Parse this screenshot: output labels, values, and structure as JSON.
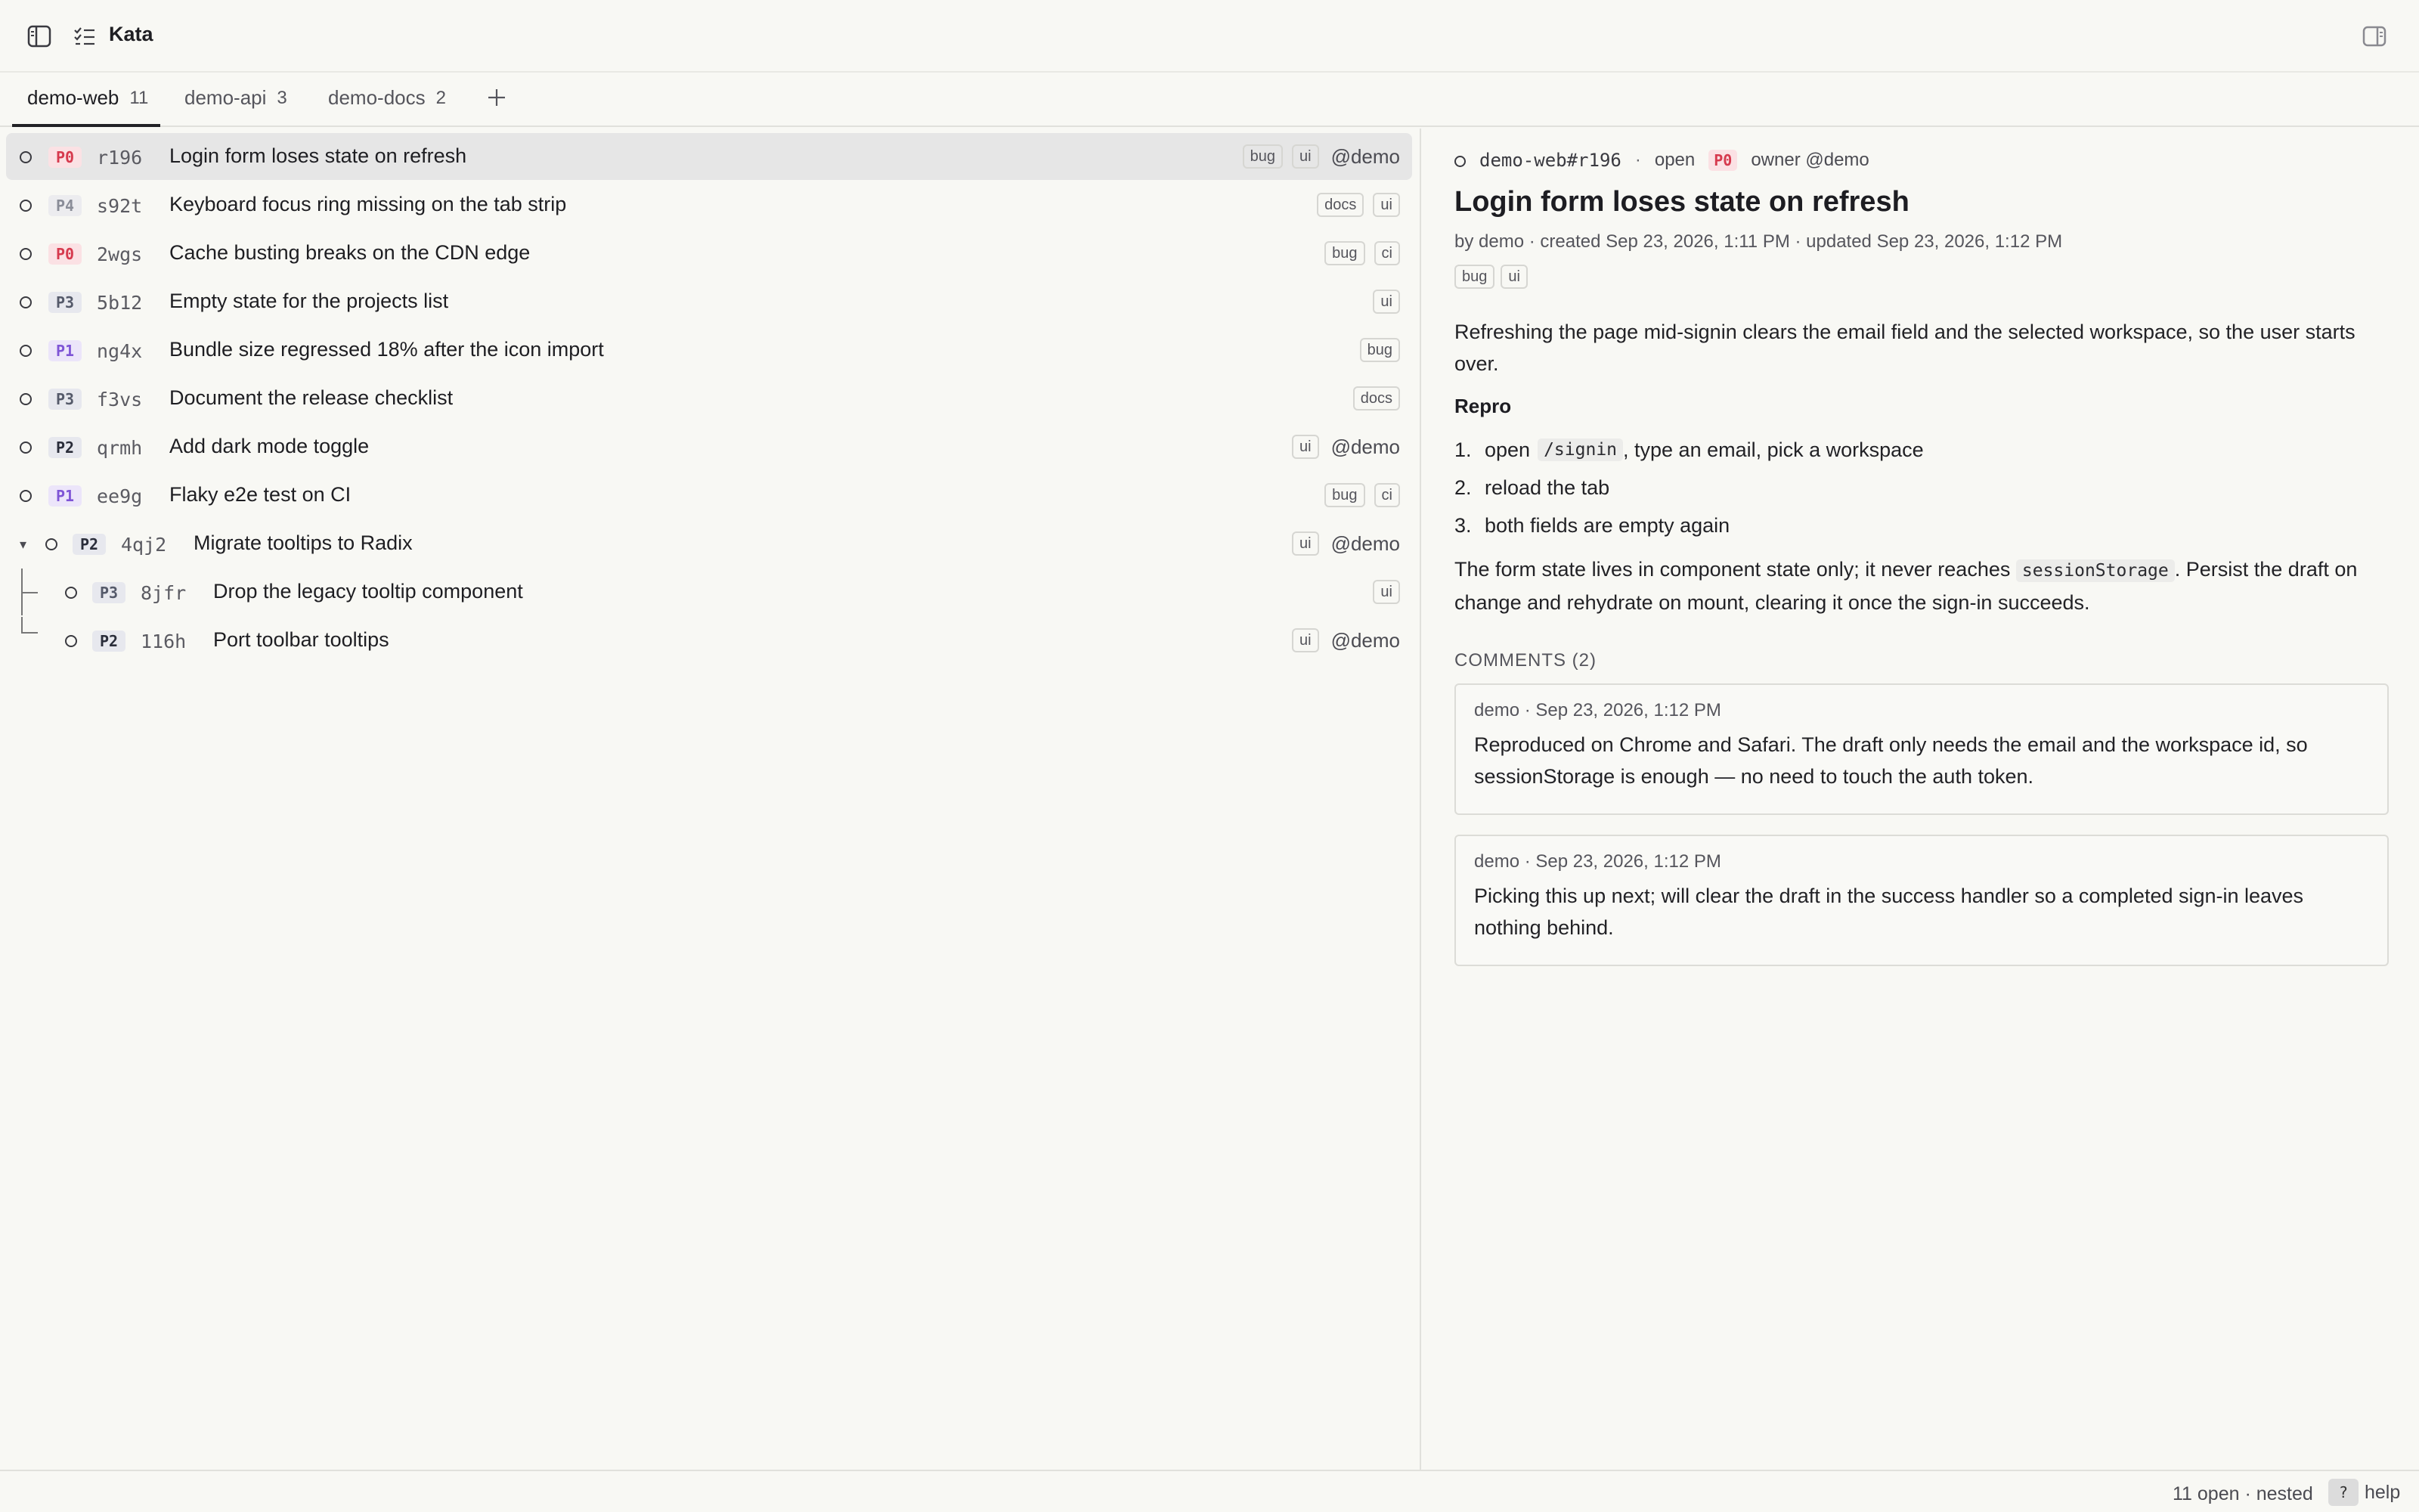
{
  "app": {
    "title": "Kata"
  },
  "tabs": [
    {
      "label": "demo-web",
      "count": "11"
    },
    {
      "label": "demo-api",
      "count": "3"
    },
    {
      "label": "demo-docs",
      "count": "2"
    }
  ],
  "icons": {
    "sidebar_toggle": "sidebar-toggle-icon",
    "tasks": "checklist-icon",
    "panel_right": "panel-right-icon",
    "add_tab": "plus-icon",
    "status_open": "open-circle-icon",
    "expand": "caret-down-icon"
  },
  "colors": {
    "p0": "#d63a4e",
    "p1": "#7f55d6",
    "selected_row": "#e6e6e6",
    "background": "#f8f8f4"
  },
  "issues": [
    {
      "prio": "P0",
      "id": "r196",
      "title": "Login form loses state on refresh",
      "tags": [
        "bug",
        "ui"
      ],
      "owner": "@demo"
    },
    {
      "prio": "P4",
      "id": "s92t",
      "title": "Keyboard focus ring missing on the tab strip",
      "tags": [
        "docs",
        "ui"
      ],
      "owner": ""
    },
    {
      "prio": "P0",
      "id": "2wgs",
      "title": "Cache busting breaks on the CDN edge",
      "tags": [
        "bug",
        "ci"
      ],
      "owner": ""
    },
    {
      "prio": "P3",
      "id": "5b12",
      "title": "Empty state for the projects list",
      "tags": [
        "ui"
      ],
      "owner": ""
    },
    {
      "prio": "P1",
      "id": "ng4x",
      "title": "Bundle size regressed 18% after the icon import",
      "tags": [
        "bug"
      ],
      "owner": ""
    },
    {
      "prio": "P3",
      "id": "f3vs",
      "title": "Document the release checklist",
      "tags": [
        "docs"
      ],
      "owner": ""
    },
    {
      "prio": "P2",
      "id": "qrmh",
      "title": "Add dark mode toggle",
      "tags": [
        "ui"
      ],
      "owner": "@demo"
    },
    {
      "prio": "P1",
      "id": "ee9g",
      "title": "Flaky e2e test on CI",
      "tags": [
        "bug",
        "ci"
      ],
      "owner": ""
    },
    {
      "prio": "P2",
      "id": "4qj2",
      "title": "Migrate tooltips to Radix",
      "tags": [
        "ui"
      ],
      "owner": "@demo"
    },
    {
      "prio": "P3",
      "id": "8jfr",
      "title": "Drop the legacy tooltip component",
      "tags": [
        "ui"
      ],
      "owner": ""
    },
    {
      "prio": "P2",
      "id": "116h",
      "title": "Port toolbar tooltips",
      "tags": [
        "ui"
      ],
      "owner": "@demo"
    }
  ],
  "detail": {
    "ref": "demo-web#r196",
    "status": "open",
    "prio": "P0",
    "owner": "owner @demo",
    "title": "Login form loses state on refresh",
    "meta": "by demo · created Sep 23, 2026, 1:11 PM · updated Sep 23, 2026, 1:12 PM",
    "tags": [
      "bug",
      "ui"
    ],
    "description": "Refreshing the page mid-signin clears the email field and the selected workspace, so the user starts over.",
    "repro_heading": "Repro",
    "steps": {
      "s1_pre": "open",
      "s1_code": "/signin",
      "s1_post": ", type an email, pick a workspace",
      "s2": "reload the tab",
      "s3": "both fields are empty again"
    },
    "note": {
      "pre": "The form state lives in component state only; it never reaches",
      "code": "sessionStorage",
      "post": ". Persist the draft on change and rehydrate on mount, clearing it once the sign-in succeeds."
    },
    "comments_heading": "COMMENTS (2)",
    "comments": [
      {
        "meta": "demo · Sep 23, 2026, 1:12 PM",
        "text": "Reproduced on Chrome and Safari. The draft only needs the email and the workspace id, so sessionStorage is enough — no need to touch the auth token."
      },
      {
        "meta": "demo · Sep 23, 2026, 1:12 PM",
        "text": "Picking this up next; will clear the draft in the success handler so a completed sign-in leaves nothing behind."
      }
    ]
  },
  "statusbar": {
    "summary": "11 open · nested",
    "help_key": "?",
    "help_label": "help"
  }
}
